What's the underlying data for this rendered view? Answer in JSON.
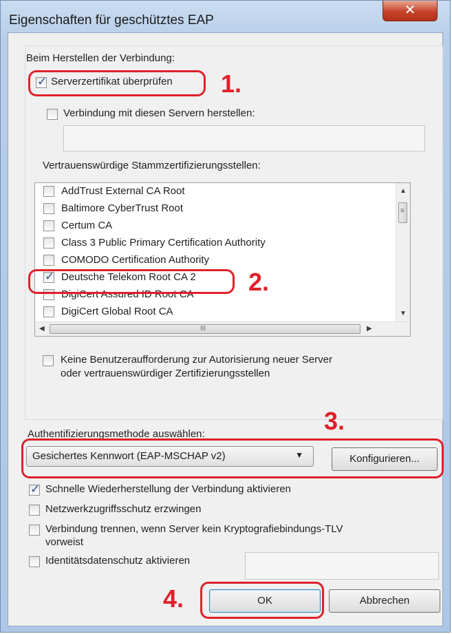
{
  "window": {
    "title": "Eigenschaften für geschütztes EAP",
    "close_glyph": "✕"
  },
  "connection": {
    "heading": "Beim Herstellen der Verbindung:",
    "verify_cert_label": "Serverzertifikat überprüfen",
    "verify_cert_checked": true,
    "connect_servers_label": "Verbindung mit diesen Servern herstellen:",
    "connect_servers_checked": false,
    "servers_value": ""
  },
  "trusted_ca": {
    "heading": "Vertrauenswürdige Stammzertifizierungsstellen:",
    "items": [
      {
        "label": "AddTrust External CA Root",
        "checked": false
      },
      {
        "label": "Baltimore CyberTrust Root",
        "checked": false
      },
      {
        "label": "Certum CA",
        "checked": false
      },
      {
        "label": "Class 3 Public Primary Certification Authority",
        "checked": false
      },
      {
        "label": "COMODO Certification Authority",
        "checked": false
      },
      {
        "label": "Deutsche Telekom Root CA 2",
        "checked": true
      },
      {
        "label": "DigiCert Assured ID Root CA",
        "checked": false
      },
      {
        "label": "DigiCert Global Root CA",
        "checked": false
      }
    ]
  },
  "no_prompt": {
    "label_line1": "Keine Benutzeraufforderung zur Autorisierung neuer Server",
    "label_line2": "oder vertrauenswürdiger Zertifizierungsstellen",
    "checked": false
  },
  "auth": {
    "heading": "Authentifizierungsmethode auswählen:",
    "method_value": "Gesichertes Kennwort (EAP-MSCHAP v2)",
    "configure_label": "Konfigurieren..."
  },
  "options": {
    "fast_reconnect_label": "Schnelle Wiederherstellung der Verbindung aktivieren",
    "fast_reconnect_checked": true,
    "nap_label": "Netzwerkzugriffsschutz erzwingen",
    "nap_checked": false,
    "disconnect_line1": "Verbindung trennen, wenn Server kein Kryptografiebindungs-TLV",
    "disconnect_line2": "vorweist",
    "disconnect_checked": false,
    "identity_privacy_label": "Identitätsdatenschutz aktivieren",
    "identity_privacy_checked": false,
    "identity_value": ""
  },
  "buttons": {
    "ok_label": "OK",
    "cancel_label": "Abbrechen"
  },
  "annotations": {
    "step1": "1.",
    "step2": "2.",
    "step3": "3.",
    "step4": "4.",
    "color": "#e0202a"
  },
  "scroll_glyphs": {
    "up": "▲",
    "down": "▼",
    "left": "◀",
    "right": "▶",
    "grip_v": "≡",
    "grip_h": "III",
    "combo_arrow": "▼"
  }
}
